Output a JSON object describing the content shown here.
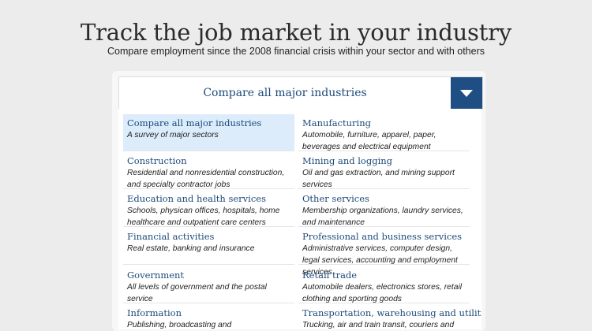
{
  "header": {
    "title": "Track the job market in your industry",
    "subtitle": "Compare employment since the 2008 financial crisis within your sector and with others"
  },
  "selector": {
    "selected_label": "Compare all major industries",
    "toggle_icon": "triangle-down-icon",
    "accent_color": "#1f4e85"
  },
  "industries": [
    {
      "name": "Compare all major industries",
      "desc": "A survey of major sectors"
    },
    {
      "name": "Manufacturing",
      "desc": "Automobile, furniture, apparel, paper, beverages and electrical equipment"
    },
    {
      "name": "Construction",
      "desc": "Residential and nonresidential construction, and specialty contractor jobs"
    },
    {
      "name": "Mining and logging",
      "desc": "Oil and gas extraction, and mining support services"
    },
    {
      "name": "Education and health services",
      "desc": "Schools, physican offices, hospitals, home healthcare and outpatient care centers"
    },
    {
      "name": "Other services",
      "desc": "Membership organizations, laundry services, and maintenance"
    },
    {
      "name": "Financial activities",
      "desc": "Real estate, banking and insurance"
    },
    {
      "name": "Professional and business services",
      "desc": "Administrative services, computer design, legal services, accounting and employment services"
    },
    {
      "name": "Government",
      "desc": "All levels of government and the postal service"
    },
    {
      "name": "Retail trade",
      "desc": "Automobile dealers, electronics stores, retail clothing and sporting goods"
    },
    {
      "name": "Information",
      "desc": "Publishing, broadcasting and telecommunications"
    },
    {
      "name": "Transportation, warehousing and utilities",
      "desc": "Trucking, air and train transit, couriers and"
    }
  ]
}
